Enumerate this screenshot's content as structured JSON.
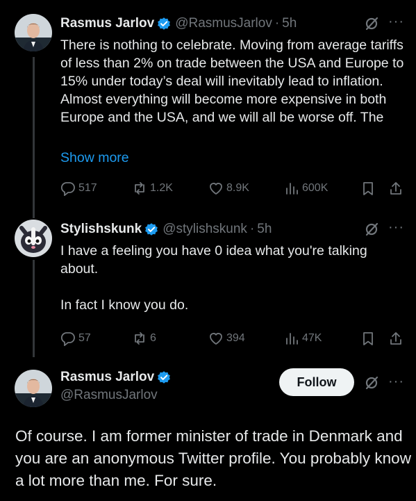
{
  "tweet1": {
    "name": "Rasmus Jarlov",
    "handle": "@RasmusJarlov",
    "separator": "·",
    "time": "5h",
    "text": "There is nothing to celebrate. Moving from average tariffs of less than 2% on trade between the USA and Europe to 15% under today’s deal will inevitably lead to inflation. Almost everything will become more expensive in both Europe and the USA, and we will all be worse off. The",
    "show_more": "Show more",
    "replies": "517",
    "reposts": "1.2K",
    "likes": "8.9K",
    "views": "600K"
  },
  "tweet2": {
    "name": "Stylishskunk",
    "handle": "@stylishskunk",
    "separator": "·",
    "time": "5h",
    "text_line1": "I have a feeling you have 0 idea what you're talking about.",
    "text_line2": "In fact I know you do.",
    "replies": "57",
    "reposts": "6",
    "likes": "394",
    "views": "47K"
  },
  "tweet3": {
    "name": "Rasmus Jarlov",
    "handle": "@RasmusJarlov",
    "follow_label": "Follow",
    "text": "Of course. I am former minister of trade in Denmark and you are an anonymous Twitter profile. You probably know a lot more than me. For sure."
  },
  "more_glyph": "···",
  "icons": {
    "verified": "verified-badge-icon",
    "grok": "grok-icon",
    "reply": "reply-icon",
    "repost": "repost-icon",
    "like": "like-icon",
    "views": "views-icon",
    "bookmark": "bookmark-icon",
    "share": "share-icon"
  },
  "colors": {
    "background": "#000000",
    "text": "#e7e9ea",
    "muted": "#71767b",
    "link": "#1d9bf0",
    "verified": "#1d9bf0",
    "follow_bg": "#eff3f4"
  }
}
